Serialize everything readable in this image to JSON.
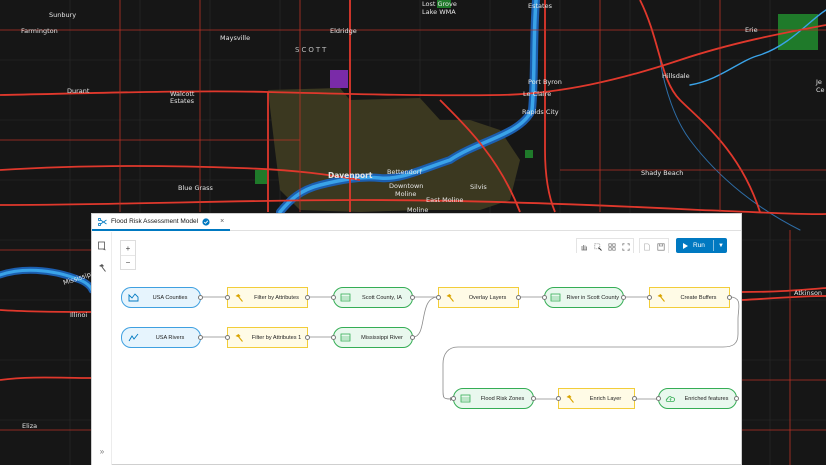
{
  "map": {
    "labels": [
      {
        "id": "sunbury",
        "text": "Sunbury"
      },
      {
        "id": "farmington",
        "text": "Farmington"
      },
      {
        "id": "maysville",
        "text": "Maysville"
      },
      {
        "id": "scott",
        "text": "SCOTT"
      },
      {
        "id": "eldridge",
        "text": "Eldridge"
      },
      {
        "id": "lostgrove1",
        "text": "Lost Grove"
      },
      {
        "id": "lostgrove2",
        "text": "Lake WMA"
      },
      {
        "id": "estates",
        "text": "Estates"
      },
      {
        "id": "erie",
        "text": "Erie"
      },
      {
        "id": "durant",
        "text": "Durant"
      },
      {
        "id": "walcott1",
        "text": "Walcott"
      },
      {
        "id": "walcott2",
        "text": "Estates"
      },
      {
        "id": "portbyron",
        "text": "Port Byron"
      },
      {
        "id": "leclaire",
        "text": "Le Claire"
      },
      {
        "id": "rapidscity",
        "text": "Rapids City"
      },
      {
        "id": "hillsdale",
        "text": "Hillsdale"
      },
      {
        "id": "je",
        "text": "Je"
      },
      {
        "id": "ce",
        "text": "Ce"
      },
      {
        "id": "bettendorf",
        "text": "Bettendorf"
      },
      {
        "id": "davenport",
        "text": "Davenport"
      },
      {
        "id": "downtown",
        "text": "Downtown"
      },
      {
        "id": "moline1",
        "text": "Moline"
      },
      {
        "id": "silvis",
        "text": "Silvis"
      },
      {
        "id": "eastmoline",
        "text": "East Moline"
      },
      {
        "id": "moline2",
        "text": "Moline"
      },
      {
        "id": "shadybeach",
        "text": "Shady Beach"
      },
      {
        "id": "bluegrass",
        "text": "Blue Grass"
      },
      {
        "id": "atkinson",
        "text": "Atkinson"
      },
      {
        "id": "illinois",
        "text": "Illinoi"
      },
      {
        "id": "eliza",
        "text": "Eliza"
      },
      {
        "id": "mississippi",
        "text": "Mississippi"
      }
    ]
  },
  "panel": {
    "tab_title": "Flood Risk Assessment Model",
    "close_glyph": "×",
    "zoom_in": "+",
    "zoom_out": "−",
    "run_label": "Run",
    "expand_glyph": "»"
  },
  "model": {
    "nodes": [
      {
        "id": "n1",
        "kind": "data",
        "icon": "polygon-layer-icon",
        "label": "USA Counties"
      },
      {
        "id": "n2",
        "kind": "tool",
        "icon": "hammer-icon",
        "label": "Filter by Attributes"
      },
      {
        "id": "n3",
        "kind": "out",
        "icon": "layer-output-icon",
        "label": "Scott County, IA"
      },
      {
        "id": "n4",
        "kind": "tool",
        "icon": "hammer-icon",
        "label": "Overlay Layers"
      },
      {
        "id": "n5",
        "kind": "out",
        "icon": "layer-output-icon",
        "label": "River in Scott County"
      },
      {
        "id": "n6",
        "kind": "tool",
        "icon": "hammer-icon",
        "label": "Create Buffers"
      },
      {
        "id": "n7",
        "kind": "data",
        "icon": "line-layer-icon",
        "label": "USA Rivers"
      },
      {
        "id": "n8",
        "kind": "tool",
        "icon": "hammer-icon",
        "label": "Filter by Attributes 1"
      },
      {
        "id": "n9",
        "kind": "out",
        "icon": "layer-output-icon",
        "label": "Mississippi River"
      },
      {
        "id": "n10",
        "kind": "out",
        "icon": "layer-output-icon",
        "label": "Flood Risk Zones"
      },
      {
        "id": "n11",
        "kind": "tool",
        "icon": "hammer-icon",
        "label": "Enrich Layer"
      },
      {
        "id": "n12",
        "kind": "out",
        "icon": "cloud-output-icon",
        "label": "Enriched features"
      }
    ]
  },
  "colors": {
    "accent": "#0079c1",
    "data_border": "#3fa0e0",
    "tool_border": "#f2cd3a",
    "output_border": "#35ad55",
    "road": "#e0382c",
    "river": "#3aa3e8"
  }
}
